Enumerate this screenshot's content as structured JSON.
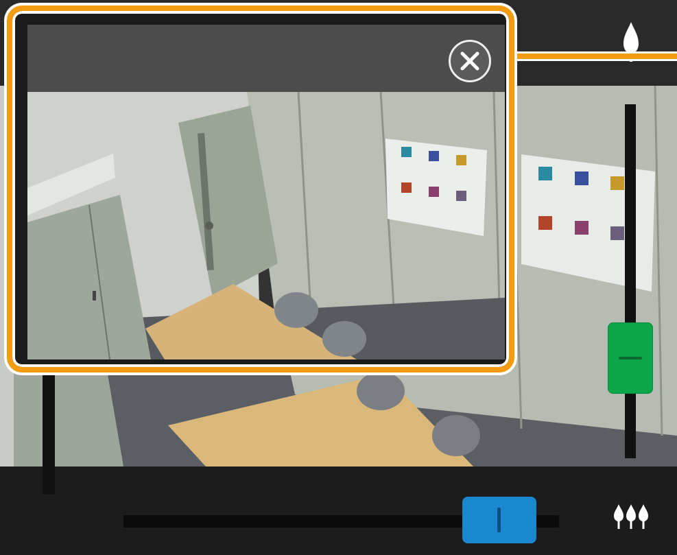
{
  "colors": {
    "accent_orange": "#f39c12",
    "zoom_slider_thumb": "#0da54a",
    "horizontal_slider_thumb": "#1a88d0",
    "header_bg": "#2a2a2a",
    "popup_header_bg": "#4c4c4c"
  },
  "popup": {
    "close_icon": "close-icon"
  },
  "controls": {
    "vertical_slider_icon": "minus-grip-icon",
    "horizontal_slider_icon": "bar-grip-icon",
    "top_right_icon": "single-drop-icon",
    "bottom_right_icon": "triple-drop-icon"
  }
}
